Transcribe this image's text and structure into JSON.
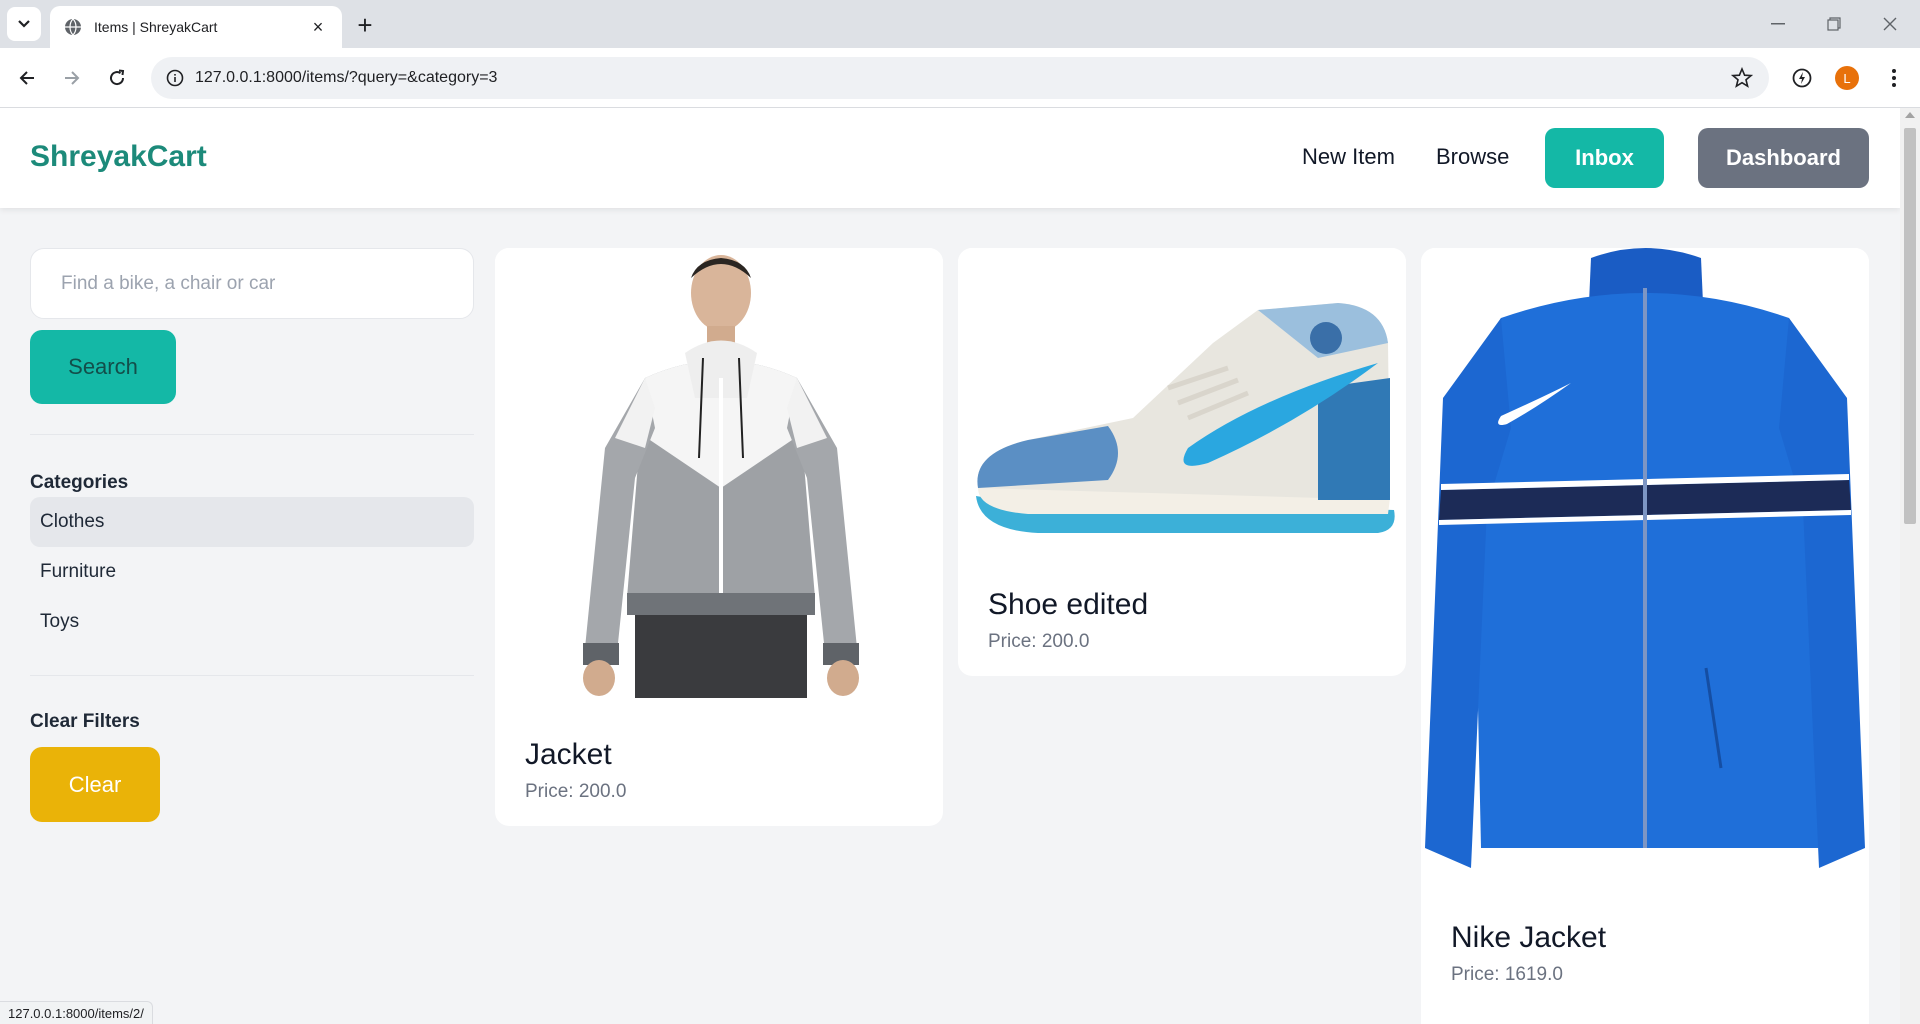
{
  "browser": {
    "tab_title": "Items | ShreyakCart",
    "url": "127.0.0.1:8000/items/?query=&category=3",
    "profile_initial": "L",
    "status_url": "127.0.0.1:8000/items/2/"
  },
  "site": {
    "brand": "ShreyakCart",
    "nav": {
      "new_item": "New Item",
      "browse": "Browse",
      "inbox": "Inbox",
      "dashboard": "Dashboard"
    }
  },
  "sidebar": {
    "search_placeholder": "Find a bike, a chair or car",
    "search_value": "",
    "search_button": "Search",
    "categories_title": "Categories",
    "categories": [
      {
        "label": "Clothes",
        "active": true
      },
      {
        "label": "Furniture",
        "active": false
      },
      {
        "label": "Toys",
        "active": false
      }
    ],
    "clear_title": "Clear Filters",
    "clear_button": "Clear"
  },
  "items": [
    {
      "name": "Jacket",
      "price": "Price: 200.0",
      "image": "grey-white-windbreaker-photo"
    },
    {
      "name": "Shoe edited",
      "price": "Price: 200.0",
      "image": "blue-white-high-top-sneaker-photo"
    },
    {
      "name": "Nike Jacket",
      "price": "Price: 1619.0",
      "image": "blue-track-jacket-photo"
    }
  ],
  "colors": {
    "brand": "#1c8a7a",
    "teal": "#14b8a6",
    "gray_button": "#6b7280",
    "yellow": "#eab308",
    "page_bg": "#f3f4f6"
  }
}
